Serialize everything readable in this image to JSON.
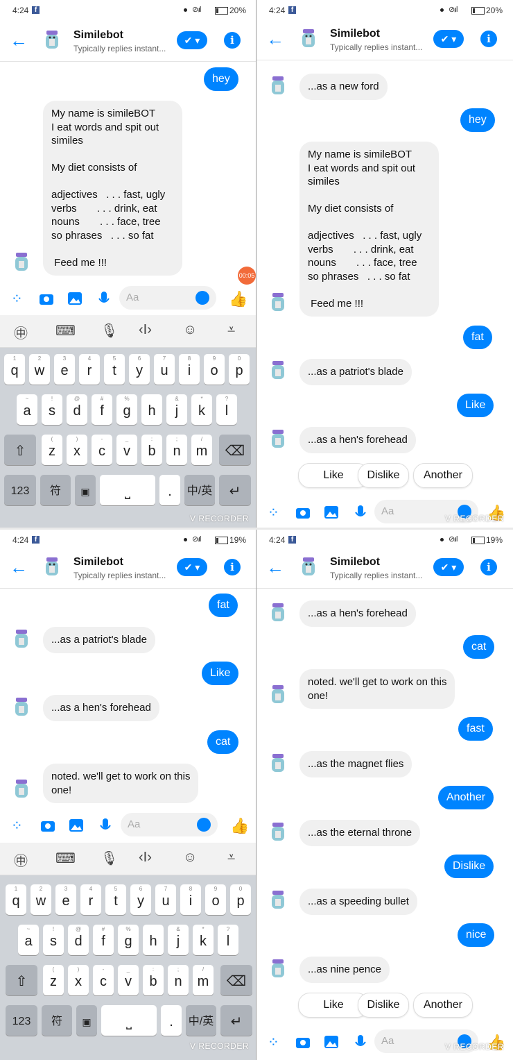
{
  "status": {
    "time": "4:24",
    "fb": "f",
    "battery_p1": "20%",
    "battery_p2": "20%",
    "battery_p3": "19%",
    "battery_p4": "19%"
  },
  "header": {
    "title": "Similebot",
    "subtitle": "Typically replies instant..."
  },
  "composer": {
    "placeholder": "Aa"
  },
  "quick_replies": [
    "Like",
    "Dislike",
    "Another"
  ],
  "recorder": {
    "watermark": "V RECORDER",
    "timer": "00:05"
  },
  "keyboard": {
    "row1": [
      "q",
      "w",
      "e",
      "r",
      "t",
      "y",
      "u",
      "i",
      "o",
      "p"
    ],
    "row1_hints": [
      "1",
      "2",
      "3",
      "4",
      "5",
      "6",
      "7",
      "8",
      "9",
      "0"
    ],
    "row2": [
      "a",
      "s",
      "d",
      "f",
      "g",
      "h",
      "j",
      "k",
      "l"
    ],
    "row2_hints": [
      "~",
      "!",
      "@",
      "#",
      "%",
      "",
      "&",
      "*",
      "?"
    ],
    "row3": [
      "z",
      "x",
      "c",
      "v",
      "b",
      "n",
      "m"
    ],
    "row3_hints": [
      "(",
      ")",
      "-",
      "_",
      ":",
      ";",
      "/"
    ],
    "num_key": "123",
    "sym_key": "符",
    "period": "."
  },
  "panels": {
    "p1": {
      "messages": [
        {
          "from": "me",
          "text": "hey"
        },
        {
          "from": "bot",
          "text": "My name is simileBOT\nI eat words and spit out\nsimiles\n\nMy diet consists of\n\nadjectives   . . . fast, ugly\nverbs       . . . drink, eat\nnouns       . . . face, tree\nso phrases   . . . so fat\n\n Feed me !!!"
        }
      ]
    },
    "p2": {
      "messages": [
        {
          "from": "bot",
          "text": "...as a new ford"
        },
        {
          "from": "me",
          "text": "hey"
        },
        {
          "from": "bot",
          "text": "My name is simileBOT\nI eat words and spit out\nsimiles\n\nMy diet consists of\n\nadjectives   . . . fast, ugly\nverbs       . . . drink, eat\nnouns       . . . face, tree\nso phrases   . . . so fat\n\n Feed me !!!"
        },
        {
          "from": "me",
          "text": "fat"
        },
        {
          "from": "bot",
          "text": "...as a patriot's blade"
        },
        {
          "from": "me",
          "text": "Like"
        },
        {
          "from": "bot",
          "text": "...as a hen's forehead"
        }
      ]
    },
    "p3": {
      "messages": [
        {
          "from": "me",
          "text": "fat"
        },
        {
          "from": "bot",
          "text": "...as a patriot's blade"
        },
        {
          "from": "me",
          "text": "Like"
        },
        {
          "from": "bot",
          "text": "...as a hen's forehead"
        },
        {
          "from": "me",
          "text": "cat"
        },
        {
          "from": "bot",
          "text": "noted. we'll get to work on this\none!"
        }
      ]
    },
    "p4": {
      "messages": [
        {
          "from": "bot",
          "text": "...as a hen's forehead"
        },
        {
          "from": "me",
          "text": "cat"
        },
        {
          "from": "bot",
          "text": "noted. we'll get to work on this\none!"
        },
        {
          "from": "me",
          "text": "fast"
        },
        {
          "from": "bot",
          "text": "...as the magnet flies"
        },
        {
          "from": "me",
          "text": "Another"
        },
        {
          "from": "bot",
          "text": "...as the eternal throne"
        },
        {
          "from": "me",
          "text": "Dislike"
        },
        {
          "from": "bot",
          "text": "...as a speeding bullet"
        },
        {
          "from": "me",
          "text": "nice"
        },
        {
          "from": "bot",
          "text": "...as nine pence"
        }
      ]
    }
  },
  "colors": {
    "accent": "#0084ff",
    "bubble_in": "#f0f0f0",
    "keyboard_bg": "#cfd3d8"
  }
}
